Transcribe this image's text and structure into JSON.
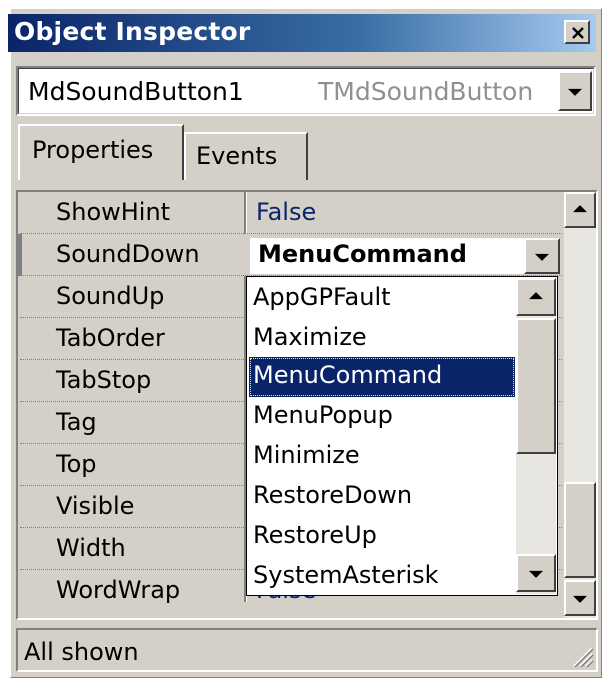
{
  "window": {
    "title": "Object Inspector"
  },
  "component_selector": {
    "name": "MdSoundButton1",
    "type": "TMdSoundButton"
  },
  "tabs": [
    {
      "label": "Properties",
      "active": true
    },
    {
      "label": "Events",
      "active": false
    }
  ],
  "properties": [
    {
      "name": "ShowHint",
      "value": "False"
    },
    {
      "name": "SoundDown",
      "value": "MenuCommand"
    },
    {
      "name": "SoundUp",
      "value": ""
    },
    {
      "name": "TabOrder",
      "value": ""
    },
    {
      "name": "TabStop",
      "value": ""
    },
    {
      "name": "Tag",
      "value": ""
    },
    {
      "name": "Top",
      "value": ""
    },
    {
      "name": "Visible",
      "value": ""
    },
    {
      "name": "Width",
      "value": ""
    },
    {
      "name": "WordWrap",
      "value": "False"
    }
  ],
  "editor": {
    "value": "MenuCommand"
  },
  "dropdown": {
    "items": [
      "AppGPFault",
      "Maximize",
      "MenuCommand",
      "MenuPopup",
      "Minimize",
      "RestoreDown",
      "RestoreUp",
      "SystemAsterisk"
    ],
    "selected": "MenuCommand"
  },
  "status": {
    "text": "All shown"
  },
  "colors": {
    "title_gradient_start": "#0a246a",
    "title_gradient_end": "#a6caf0",
    "selection": "#0a246a",
    "value_text": "#0a246a",
    "face": "#d4d0c8"
  }
}
